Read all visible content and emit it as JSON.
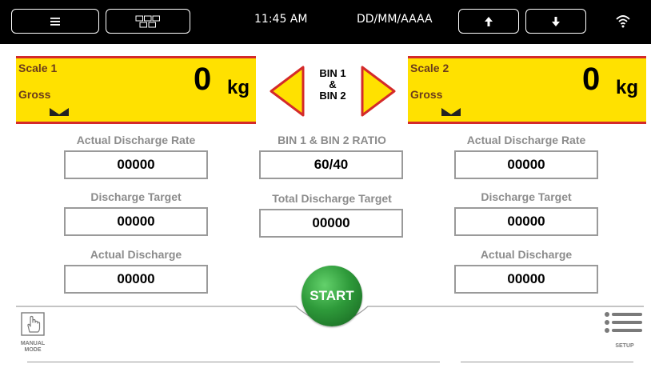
{
  "topbar": {
    "time": "11:45 AM",
    "date": "DD/MM/AAAA",
    "menu_icon": "hamburger-icon",
    "grid_icon": "grid-icon",
    "up_icon": "arrow-up-icon",
    "down_icon": "arrow-down-icon",
    "wifi_icon": "wifi-icon"
  },
  "scale1": {
    "name": "Scale 1",
    "mode": "Gross",
    "value": "0",
    "unit": "kg"
  },
  "scale2": {
    "name": "Scale 2",
    "mode": "Gross",
    "value": "0",
    "unit": "kg"
  },
  "bin_selector": {
    "line1": "BIN 1",
    "line2": "&",
    "line3": "BIN 2"
  },
  "left": {
    "rate_label": "Actual Discharge Rate",
    "rate_value": "00000",
    "target_label": "Discharge Target",
    "target_value": "00000",
    "actual_label": "Actual Discharge",
    "actual_value": "00000"
  },
  "center": {
    "ratio_label": "BIN 1 & BIN 2 RATIO",
    "ratio_value": "60/40",
    "total_label": "Total Discharge Target",
    "total_value": "00000",
    "start_label": "START"
  },
  "right": {
    "rate_label": "Actual Discharge Rate",
    "rate_value": "00000",
    "target_label": "Discharge Target",
    "target_value": "00000",
    "actual_label": "Actual Discharge",
    "actual_value": "00000"
  },
  "footer": {
    "manual_line1": "MANUAL",
    "manual_line2": "MODE",
    "setup_label": "SETUP"
  },
  "colors": {
    "scale_bg": "#ffe100",
    "scale_border": "#d42a2a",
    "start_green": "#2e9a3a",
    "label_gray": "#8c8c8c"
  }
}
